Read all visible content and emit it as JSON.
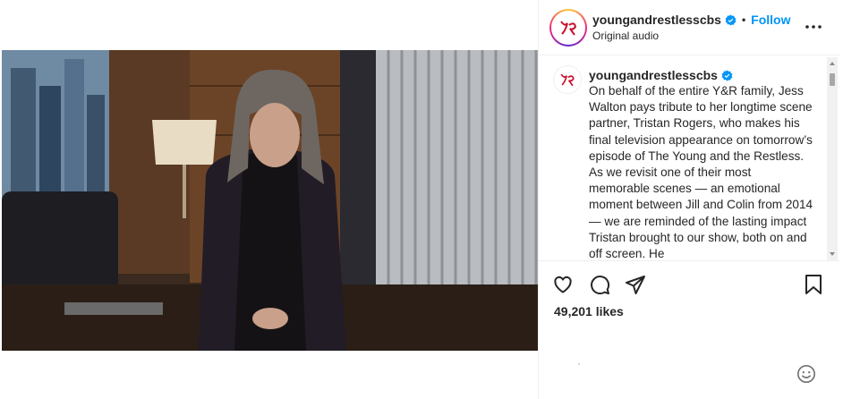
{
  "post": {
    "username": "youngandrestlesscbs",
    "follow_label": "Follow",
    "separator": "•",
    "audio_label": "Original audio"
  },
  "caption": {
    "username": "youngandrestlesscbs",
    "text": "On behalf of the entire Y&R family, Jess Walton pays tribute to her longtime scene partner, Tristan Rogers, who makes his final television appearance on tomorrow’s episode of The Young and the Restless. As we revisit one of their most memorable scenes — an emotional moment between Jill and Colin from 2014— we are reminded of the lasting impact Tristan brought to our show, both on and off screen. He"
  },
  "engagement": {
    "likes_text": "49,201 likes"
  },
  "icons": {
    "more": "more-options-icon",
    "verified": "verified-badge-icon",
    "like": "heart-icon",
    "comment": "comment-icon",
    "share": "share-icon",
    "save": "bookmark-icon",
    "mute": "muted-speaker-icon",
    "emoji": "emoji-icon"
  },
  "colors": {
    "accent": "#0095f6",
    "text": "#262626",
    "border": "#efefef",
    "logo_red": "#c8102e"
  }
}
